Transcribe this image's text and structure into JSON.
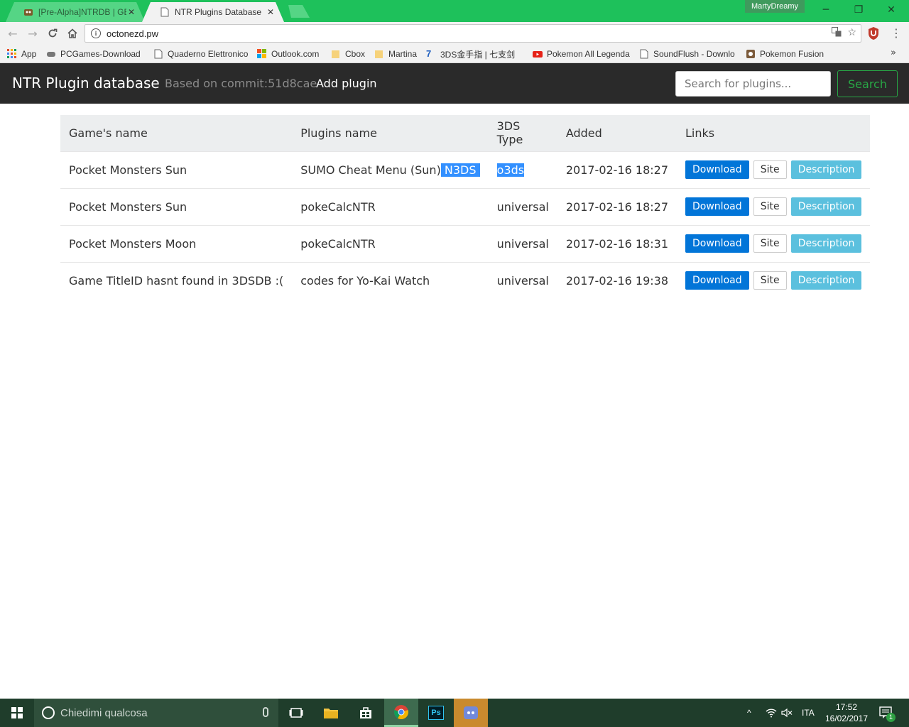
{
  "browser": {
    "tabs": [
      {
        "title": "[Pre-Alpha]NTRDB | GBA"
      },
      {
        "title": "NTR Plugins Database"
      }
    ],
    "profile": "MartyDreamy",
    "url": "octonezd.pw",
    "bookmarks": [
      {
        "label": "App"
      },
      {
        "label": "PCGames-Download"
      },
      {
        "label": "Quaderno Elettronico"
      },
      {
        "label": "Outlook.com"
      },
      {
        "label": "Cbox"
      },
      {
        "label": "Martina"
      },
      {
        "label": "3DS金手指 | 七支剑"
      },
      {
        "label": "Pokemon All Legenda"
      },
      {
        "label": "SoundFlush - Downlo"
      },
      {
        "label": "Pokemon Fusion"
      }
    ]
  },
  "site": {
    "brand": "NTR Plugin database",
    "commit": "Based on commit:51d8cae",
    "add_plugin": "Add plugin",
    "search_placeholder": "Search for plugins...",
    "search_button": "Search"
  },
  "table": {
    "headers": [
      "Game's name",
      "Plugins name",
      "3DS Type",
      "Added",
      "Links"
    ],
    "rows": [
      {
        "game": "Pocket Monsters Sun",
        "plugin": "SUMO Cheat Menu (Sun)",
        "plugin_tag": "N3DS",
        "type": "o3ds",
        "added": "2017-02-16 18:27"
      },
      {
        "game": "Pocket Monsters Sun",
        "plugin": "pokeCalcNTR",
        "type": "universal",
        "added": "2017-02-16 18:27"
      },
      {
        "game": "Pocket Monsters Moon",
        "plugin": "pokeCalcNTR",
        "type": "universal",
        "added": "2017-02-16 18:31"
      },
      {
        "game": "Game TitleID hasnt found in 3DSDB :(",
        "plugin": "codes for Yo-Kai Watch",
        "type": "universal",
        "added": "2017-02-16 19:38"
      }
    ],
    "links": {
      "download": "Download",
      "site": "Site",
      "description": "Description"
    }
  },
  "taskbar": {
    "search_text": "Chiedimi qualcosa",
    "language": "ITA",
    "time": "17:52",
    "date": "16/02/2017",
    "notification_count": "1"
  },
  "colors": {
    "chrome_frame": "#1ec15b",
    "navbar": "#2a2a2a",
    "download": "#0275d8",
    "description": "#5bc0de",
    "search_outline": "#28a745",
    "selection": "#3390ff"
  }
}
